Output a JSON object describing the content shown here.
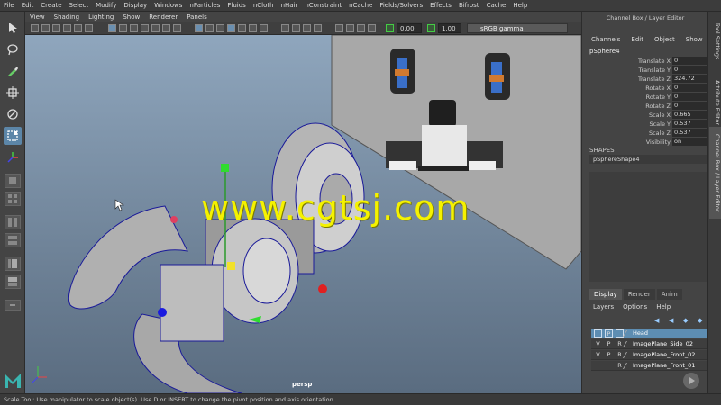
{
  "menubar": [
    "File",
    "Edit",
    "Create",
    "Select",
    "Modify",
    "Display",
    "Windows",
    "nParticles",
    "Fluids",
    "nCloth",
    "nHair",
    "nConstraint",
    "nCache",
    "Fields/Solvers",
    "Effects",
    "Bifrost",
    "Cache",
    "Help"
  ],
  "viewport_menu": [
    "View",
    "Shading",
    "Lighting",
    "Show",
    "Renderer",
    "Panels"
  ],
  "viewport_toolbar": {
    "exposure": "0.00",
    "gamma_value": "1.00",
    "color_space": "sRGB gamma"
  },
  "viewport_label": "persp",
  "watermark": "www.cgtsj.com",
  "channel_box": {
    "title": "Channel Box / Layer Editor",
    "menu": [
      "Channels",
      "Edit",
      "Object",
      "Show"
    ],
    "object": "pSphere4",
    "attributes": [
      {
        "label": "Translate X",
        "value": "0"
      },
      {
        "label": "Translate Y",
        "value": "0"
      },
      {
        "label": "Translate Z",
        "value": "324.72"
      },
      {
        "label": "Rotate X",
        "value": "0"
      },
      {
        "label": "Rotate Y",
        "value": "0"
      },
      {
        "label": "Rotate Z",
        "value": "0"
      },
      {
        "label": "Scale X",
        "value": "0.665"
      },
      {
        "label": "Scale Y",
        "value": "0.537"
      },
      {
        "label": "Scale Z",
        "value": "0.537"
      },
      {
        "label": "Visibility",
        "value": "on"
      }
    ],
    "shapes_header": "SHAPES",
    "shape_name": "pSphereShape4"
  },
  "side_tabs": [
    "Tool Settings",
    "Attribute Editor",
    "Channel Box / Layer Editor"
  ],
  "layer_editor": {
    "tabs": [
      "Display",
      "Render",
      "Anim"
    ],
    "menu": [
      "Layers",
      "Options",
      "Help"
    ],
    "layers": [
      {
        "v": "",
        "p": "P",
        "r": "",
        "name": "Head"
      },
      {
        "v": "V",
        "p": "P",
        "r": "R",
        "name": "ImagePlane_Side_02"
      },
      {
        "v": "V",
        "p": "P",
        "r": "R",
        "name": "ImagePlane_Front_02"
      },
      {
        "v": "",
        "p": "",
        "r": "R",
        "name": "ImagePlane_Front_01"
      }
    ]
  },
  "status": "Scale Tool: Use manipulator to scale object(s). Use D or INSERT to change the pivot position and axis orientation.",
  "colors": {
    "accent": "#5d8db2",
    "watermark": "#f5f200",
    "viewport_top": "#8fa6bd",
    "viewport_bottom": "#5a6c80"
  }
}
